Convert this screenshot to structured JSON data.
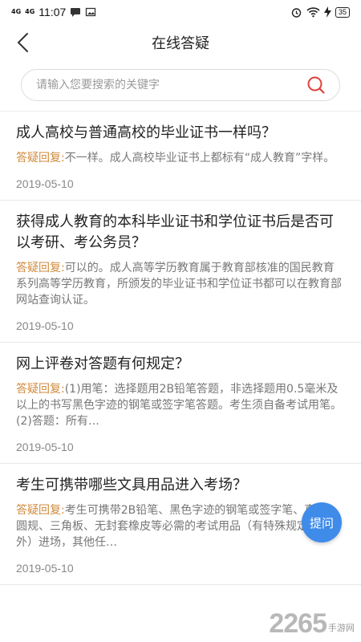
{
  "status_bar": {
    "signal1": "4G",
    "signal2": "4G",
    "time": "11:07",
    "battery": "35"
  },
  "nav": {
    "title": "在线答疑"
  },
  "search": {
    "placeholder": "请输入您要搜索的关键字"
  },
  "answer_label": "答疑回复:",
  "items": [
    {
      "question": "成人高校与普通高校的毕业证书一样吗？",
      "answer": "不一样。成人高校毕业证书上都标有“成人教育”字样。",
      "date": "2019-05-10"
    },
    {
      "question": "获得成人教育的本科毕业证书和学位证书后是否可以考研、考公务员？",
      "answer": "可以的。成人高等学历教育属于教育部核准的国民教育系列高等学历教育，所颁发的毕业证书和学位证书都可以在教育部网站查询认证。",
      "date": "2019-05-10"
    },
    {
      "question": "网上评卷对答题有何规定？",
      "answer": "(1)用笔：选择题用2B铅笔答题，非选择题用0.5毫米及以上的书写黑色字迹的钢笔或签字笔答题。考生须自备考试用笔。 (2)答题：所有…",
      "date": "2019-05-10"
    },
    {
      "question": "考生可携带哪些文具用品进入考场？",
      "answer": "考生可携带2B铅笔、黑色字迹的钢笔或签字笔、直尺、圆规、三角板、无封套橡皮等必需的考试用品（有特殊规定的除外）进场，其他任…",
      "date": "2019-05-10"
    }
  ],
  "ask_button": "提问",
  "watermark": {
    "number": "2265",
    "text": "手游网"
  },
  "colors": {
    "accent": "#3f8bea",
    "answer_label": "#d08a3c",
    "search_icon": "#e0403a"
  }
}
